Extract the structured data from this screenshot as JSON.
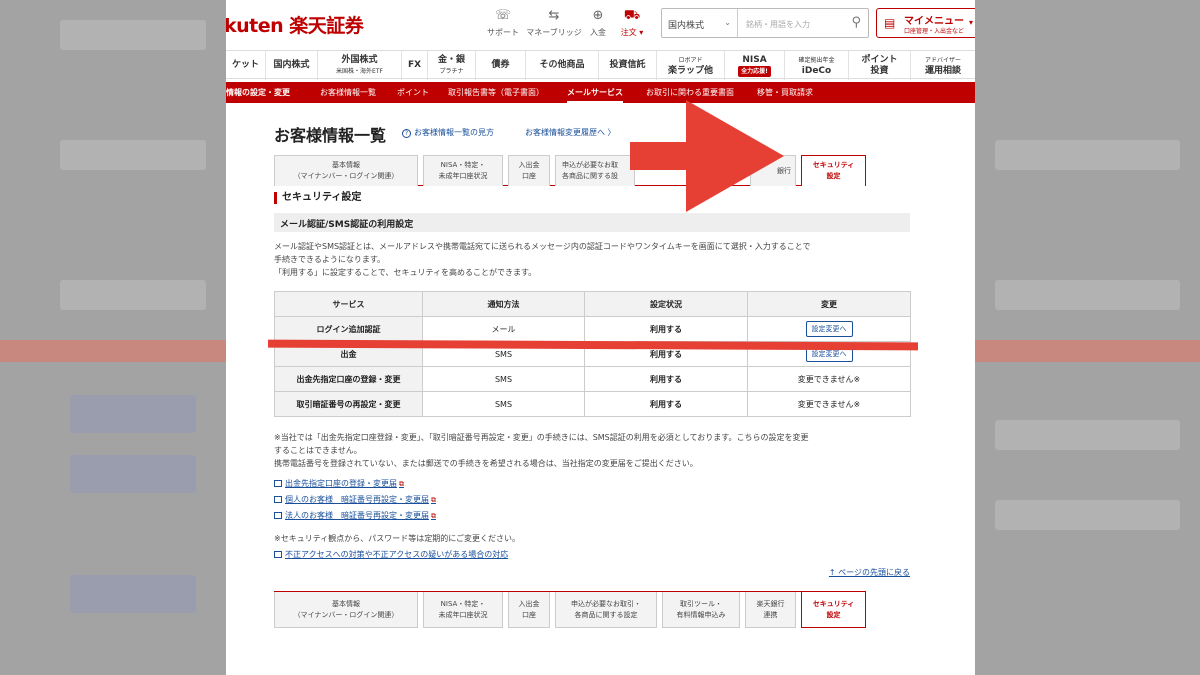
{
  "header": {
    "logo": "kuten 楽天証券",
    "icons": [
      {
        "label": "サポート",
        "icon": "support-icon"
      },
      {
        "label": "マネーブリッジ",
        "icon": "bank-icon"
      },
      {
        "label": "入金",
        "icon": "deposit-icon"
      },
      {
        "label": "注文 ▾",
        "icon": "cart-icon"
      }
    ],
    "search_select": "国内株式",
    "search_placeholder": "銘柄・用語を入力",
    "mymenu_title": "マイメニュー",
    "mymenu_sub": "口座管理・入出金など"
  },
  "nav": [
    {
      "label": "ケット"
    },
    {
      "label": "国内株式"
    },
    {
      "label": "外国株式",
      "sub": "米国株・海外ETF"
    },
    {
      "label": "FX"
    },
    {
      "label": "金・銀",
      "sub": "プラチナ"
    },
    {
      "label": "債券"
    },
    {
      "label": "その他商品"
    },
    {
      "label": "投資信託"
    },
    {
      "label": "ロボアド",
      "sub": "楽ラップ他"
    },
    {
      "label": "NISA",
      "badge": "全力応援!"
    },
    {
      "label": "iDeCo",
      "top": "確定拠出年金"
    },
    {
      "label": "ポイント",
      "sub": "投資"
    },
    {
      "label": "アドバイザー",
      "sub": "運用相談"
    }
  ],
  "subnav": [
    "情報の設定・変更",
    "お客様情報一覧",
    "ポイント",
    "取引報告書等（電子書面）",
    "メールサービス",
    "お取引に関わる重要書面",
    "移管・買取請求"
  ],
  "page": {
    "title": "お客様情報一覧",
    "link1": "お客様情報一覧の見方",
    "link2": "お客様情報変更履歴へ 〉"
  },
  "tabs": [
    {
      "l1": "基本情報",
      "l2": "（マイナンバー・ログイン関連）"
    },
    {
      "l1": "NISA・特定・",
      "l2": "未成年口座状況"
    },
    {
      "l1": "入出金",
      "l2": "口座"
    },
    {
      "l1": "申込が必要なお取引・",
      "l2": "各商品に関する設定"
    },
    {
      "l1": "取引ツール・",
      "l2": "有料情報申込み"
    },
    {
      "l1": "楽天銀行",
      "l2": "連携"
    },
    {
      "l1": "セキュリティ",
      "l2": "設定"
    }
  ],
  "tabs_top_visible": [
    {
      "l1": "基本情報",
      "l2": "（マイナンバー・ログイン関連）"
    },
    {
      "l1": "NISA・特定・",
      "l2": "未成年口座状況"
    },
    {
      "l1": "入出金",
      "l2": "口座"
    },
    {
      "l1": "申込が必要なお取",
      "l2": "各商品に関する設"
    },
    {
      "l1": "銀行",
      "l2": ""
    },
    {
      "l1": "セキュリティ",
      "l2": "設定"
    }
  ],
  "section": {
    "heading": "セキュリティ設定",
    "subheading": "メール認証/SMS認証の利用設定",
    "desc1": "メール認証やSMS認証とは、メールアドレスや携帯電話宛てに送られるメッセージ内の認証コードやワンタイムキーを画面にて選択・入力することで",
    "desc2": "手続きできるようになります。",
    "desc3": "「利用する」に設定することで、セキュリティを高めることができます。"
  },
  "table": {
    "headers": [
      "サービス",
      "通知方法",
      "設定状況",
      "変更"
    ],
    "rows": [
      {
        "service": "ログイン追加認証",
        "method": "メール",
        "status": "利用する",
        "change": "設定変更へ",
        "button": true
      },
      {
        "service": "出金",
        "method": "SMS",
        "status": "利用する",
        "change": "設定変更へ",
        "button": true
      },
      {
        "service": "出金先指定口座の登録・変更",
        "method": "SMS",
        "status": "利用する",
        "change": "変更できません※",
        "button": false
      },
      {
        "service": "取引暗証番号の再設定・変更",
        "method": "SMS",
        "status": "利用する",
        "change": "変更できません※",
        "button": false
      }
    ]
  },
  "notes": {
    "n1": "※当社では「出金先指定口座登録・変更」、「取引暗証番号再設定・変更」の手続きには、SMS認証の利用を必須としております。こちらの設定を変更",
    "n2": "することはできません。",
    "n3": "携帯電話番号を登録されていない、または郵送での手続きを希望される場合は、当社指定の変更届をご提出ください。"
  },
  "links": [
    "出金先指定口座の登録・変更届",
    "個人のお客様　暗証番号再設定・変更届",
    "法人のお客様　暗証番号再設定・変更届"
  ],
  "note_password": "※セキュリティ観点から、パスワード等は定期的にご変更ください。",
  "link_unauthorized": "不正アクセスへの対策や不正アクセスの疑いがある場合の対応",
  "back_to_top": "↑ ページの先頭に戻る",
  "colors": {
    "brand": "#bf0000",
    "link": "#1a4f9c",
    "annotation": "#e64035"
  }
}
